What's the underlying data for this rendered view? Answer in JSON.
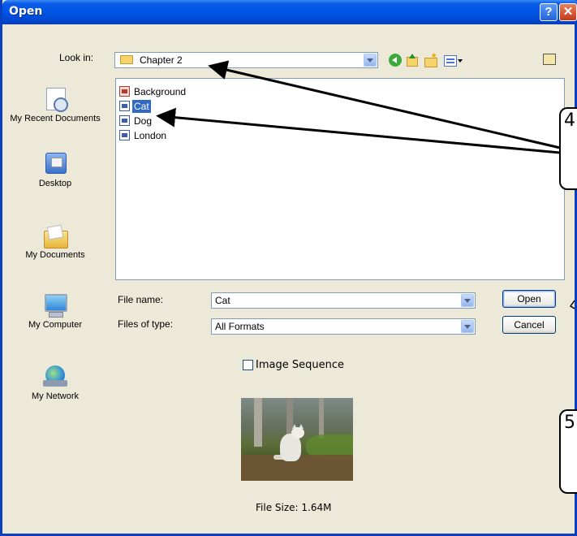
{
  "window": {
    "title": "Open",
    "help_glyph": "?",
    "close_glyph": "✕"
  },
  "toolbar": {
    "look_in_label": "Look in:",
    "look_in_value": "Chapter 2",
    "icons": [
      "back-icon",
      "up-folder-icon",
      "new-folder-icon",
      "views-menu-icon",
      "preview-icon"
    ]
  },
  "places": [
    {
      "label": "My Recent Documents",
      "icon": "recent-documents-icon"
    },
    {
      "label": "Desktop",
      "icon": "desktop-icon"
    },
    {
      "label": "My Documents",
      "icon": "my-documents-icon"
    },
    {
      "label": "My Computer",
      "icon": "my-computer-icon"
    },
    {
      "label": "My Network",
      "icon": "my-network-icon"
    }
  ],
  "files": [
    {
      "name": "Background",
      "icon": "presentation-file-icon",
      "selected": false
    },
    {
      "name": "Cat",
      "icon": "image-file-icon",
      "selected": true
    },
    {
      "name": "Dog",
      "icon": "image-file-icon",
      "selected": false
    },
    {
      "name": "London",
      "icon": "image-file-icon",
      "selected": false
    }
  ],
  "form": {
    "file_name_label": "File name:",
    "file_name_value": "Cat",
    "files_of_type_label": "Files of type:",
    "files_of_type_value": "All Formats",
    "open_label": "Open",
    "cancel_label": "Cancel",
    "image_sequence_label": "Image Sequence",
    "image_sequence_checked": false
  },
  "preview": {
    "file_size_label": "File Size: 1.64M"
  },
  "callouts": [
    {
      "number": "4"
    },
    {
      "number": "5"
    }
  ],
  "colors": {
    "titlebar": "#0055E5",
    "dialog_bg": "#ECE9D8",
    "selection": "#316AC5"
  }
}
